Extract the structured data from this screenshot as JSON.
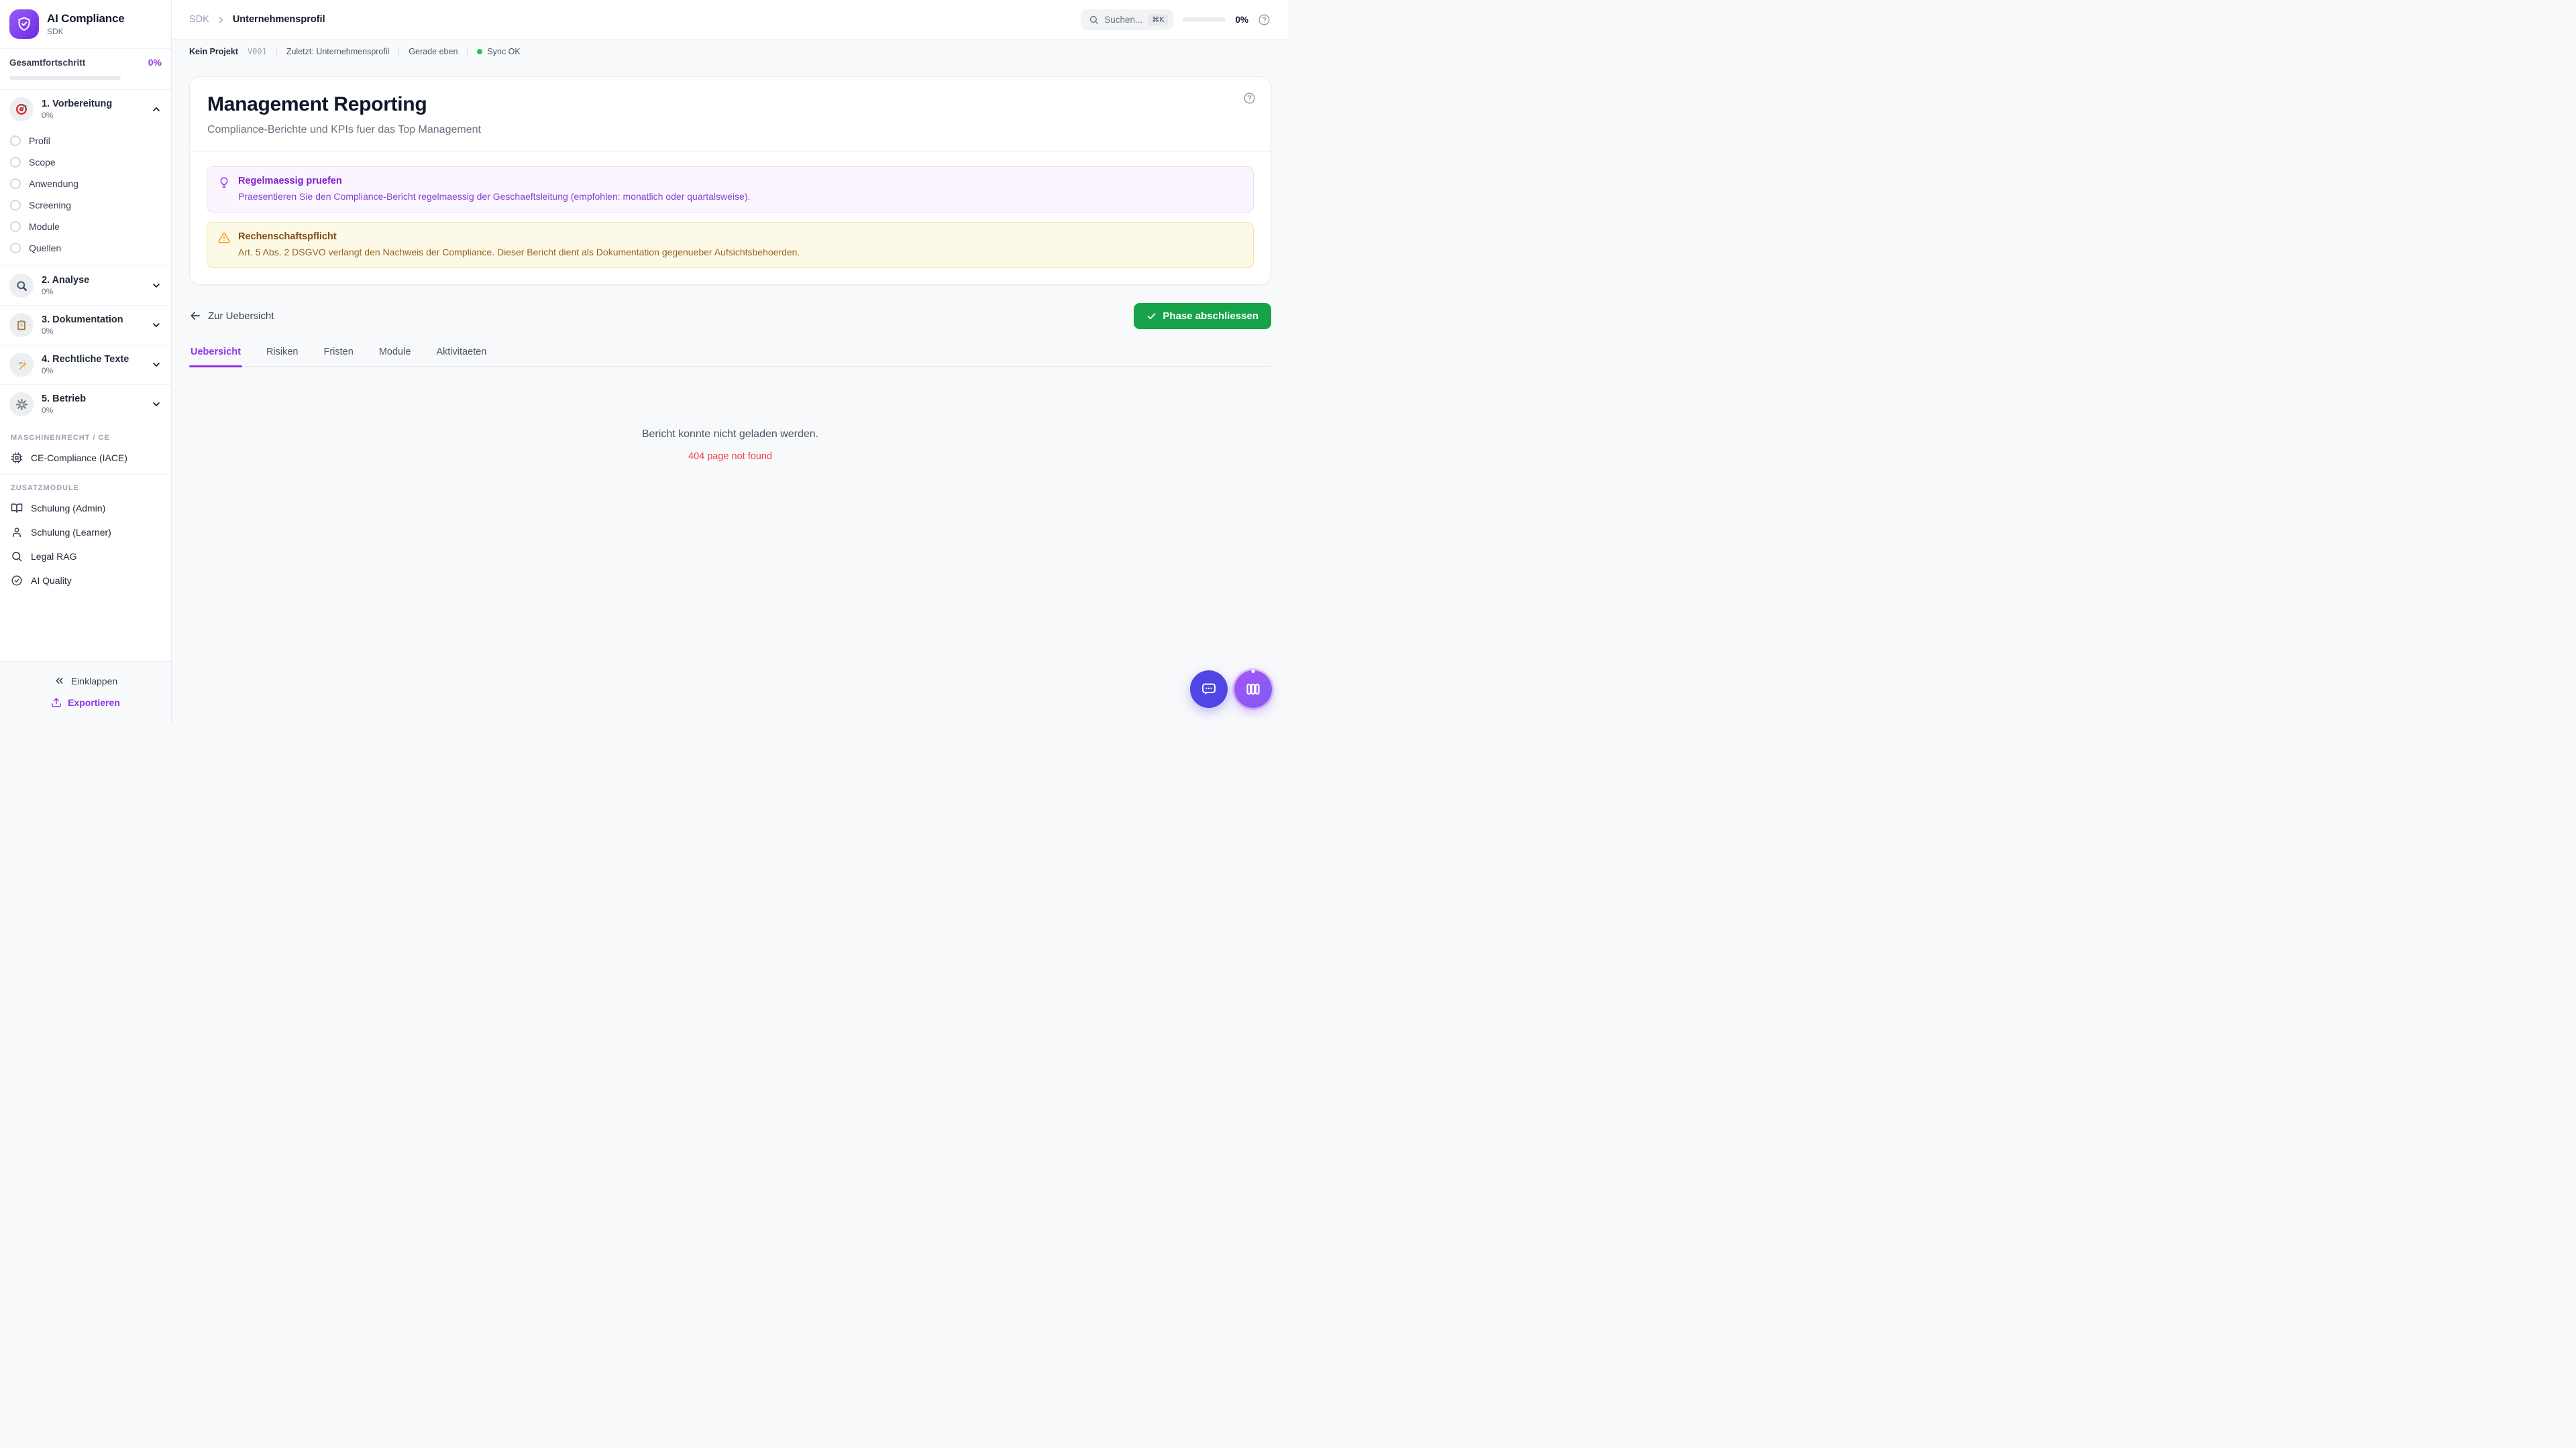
{
  "colors": {
    "accent_purple": "#9333ea",
    "logo_gradient": [
      "#9a5cf6",
      "#6d2ae8"
    ],
    "complete_green": "#16a34a",
    "sync_green": "#22c55e",
    "error_red": "#ef4444",
    "warning_amber": "#f59e0b",
    "chat_fab_indigo": "#4f46e5"
  },
  "sidebar": {
    "brand": {
      "title": "AI Compliance",
      "subtitle": "SDK",
      "icon": "shield-check-icon"
    },
    "overall": {
      "label": "Gesamtfortschritt",
      "percent": "0%"
    },
    "phases": [
      {
        "label": "1. Vorbereitung",
        "percent": "0%",
        "icon": "target-icon",
        "state": "expanded",
        "items": [
          {
            "label": "Profil"
          },
          {
            "label": "Scope"
          },
          {
            "label": "Anwendung"
          },
          {
            "label": "Screening"
          },
          {
            "label": "Module"
          },
          {
            "label": "Quellen"
          }
        ]
      },
      {
        "label": "2. Analyse",
        "percent": "0%",
        "icon": "magnifier-icon",
        "state": "collapsed"
      },
      {
        "label": "3. Dokumentation",
        "percent": "0%",
        "icon": "clipboard-icon",
        "state": "collapsed"
      },
      {
        "label": "4. Rechtliche Texte",
        "percent": "0%",
        "icon": "memo-pencil-icon",
        "state": "collapsed"
      },
      {
        "label": "5. Betrieb",
        "percent": "0%",
        "icon": "gear-icon",
        "state": "collapsed"
      }
    ],
    "machine_section": {
      "header": "MASCHINENRECHT / CE",
      "items": [
        {
          "label": "CE-Compliance (IACE)",
          "icon": "cpu-icon"
        }
      ]
    },
    "extra_section": {
      "header": "ZUSATZMODULE",
      "items": [
        {
          "label": "Schulung (Admin)",
          "icon": "book-icon"
        },
        {
          "label": "Schulung (Learner)",
          "icon": "person-icon"
        },
        {
          "label": "Legal RAG",
          "icon": "search-icon"
        },
        {
          "label": "AI Quality",
          "icon": "check-circle-icon"
        }
      ]
    },
    "footer": {
      "collapse": "Einklappen",
      "export": "Exportieren"
    }
  },
  "topbar": {
    "breadcrumb": {
      "root": "SDK",
      "current": "Unternehmensprofil"
    },
    "search": {
      "placeholder": "Suchen...",
      "shortcut": "⌘K"
    },
    "progress": {
      "percent": "0%"
    }
  },
  "statusbar": {
    "project": "Kein Projekt",
    "version": "V001",
    "last_label": "Zuletzt:",
    "last_value": "Unternehmensprofil",
    "time": "Gerade eben",
    "sync_label": "Sync OK"
  },
  "page": {
    "title": "Management Reporting",
    "subtitle": "Compliance-Berichte und KPIs fuer das Top Management",
    "tip": {
      "title": "Regelmaessig pruefen",
      "text": "Praesentieren Sie den Compliance-Bericht regelmaessig der Geschaeftsleitung (empfohlen: monatlich oder quartalsweise)."
    },
    "warning": {
      "title": "Rechenschaftspflicht",
      "text": "Art. 5 Abs. 2 DSGVO verlangt den Nachweis der Compliance. Dieser Bericht dient als Dokumentation gegenueber Aufsichtsbehoerden."
    },
    "back_link": "Zur Uebersicht",
    "complete_button": "Phase abschliessen",
    "tabs": [
      {
        "label": "Uebersicht",
        "active": true
      },
      {
        "label": "Risiken",
        "active": false
      },
      {
        "label": "Fristen",
        "active": false
      },
      {
        "label": "Module",
        "active": false
      },
      {
        "label": "Aktivitaeten",
        "active": false
      }
    ],
    "empty": {
      "message": "Bericht konnte nicht geladen werden.",
      "error": "404 page not found"
    }
  }
}
